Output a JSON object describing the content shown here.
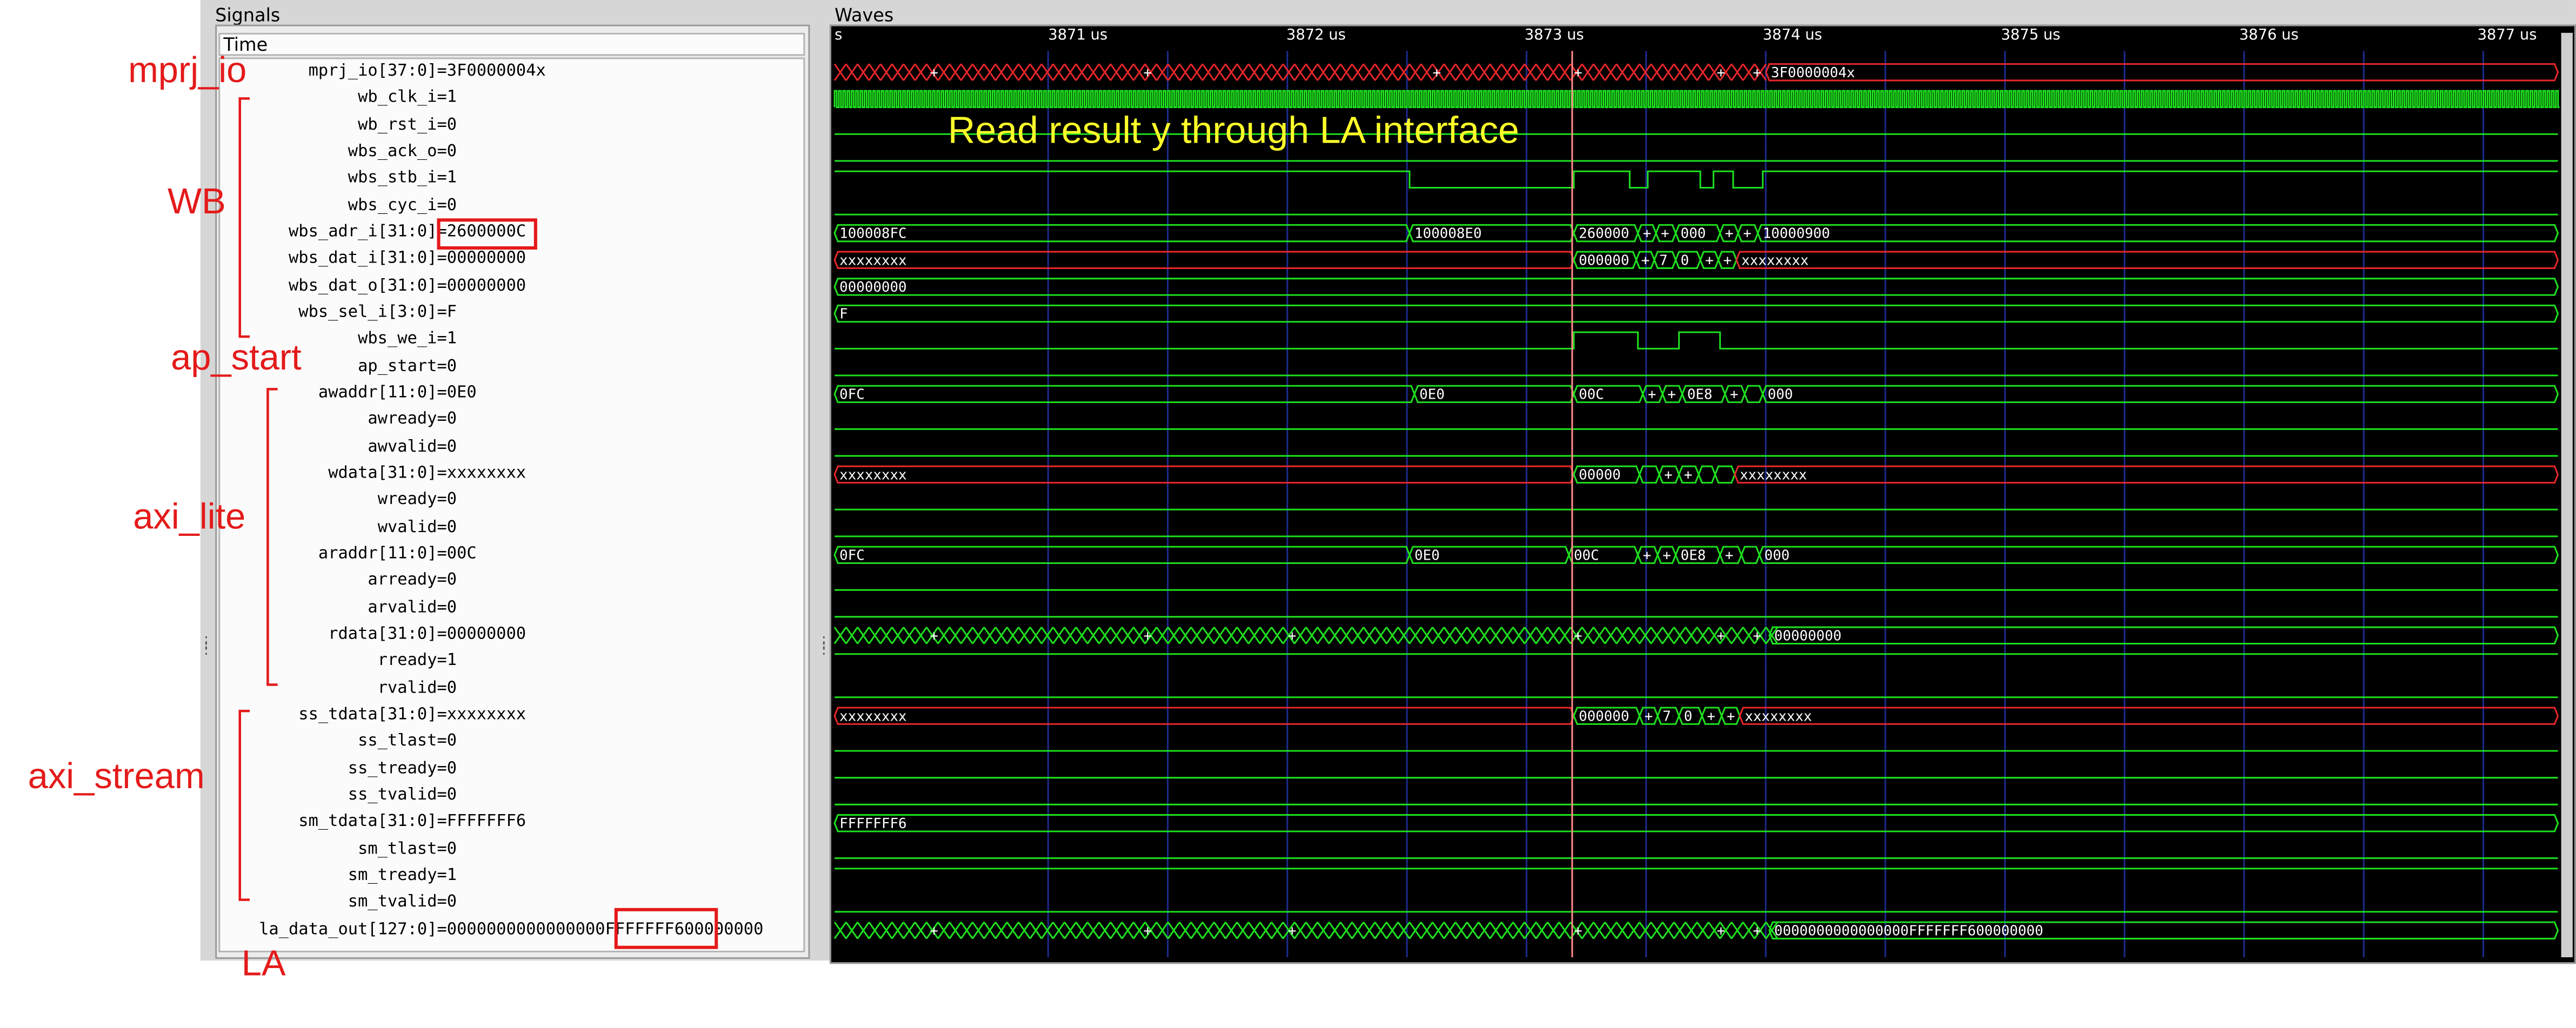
{
  "panes": {
    "signals_title": "Signals",
    "waves_title": "Waves",
    "time_header": "Time"
  },
  "time_ticks": [
    {
      "label": "s",
      "us": 3870.0
    },
    {
      "label": "3871 us",
      "us": 3871
    },
    {
      "label": "3872 us",
      "us": 3872
    },
    {
      "label": "3873 us",
      "us": 3873
    },
    {
      "label": "3874 us",
      "us": 3874
    },
    {
      "label": "3875 us",
      "us": 3875
    },
    {
      "label": "3876 us",
      "us": 3876
    },
    {
      "label": "3877 us",
      "us": 3877
    }
  ],
  "signals": [
    {
      "name": "mprj_io[37:0]",
      "value": "=3F0000004x"
    },
    {
      "name": "wb_clk_i",
      "value": "=1"
    },
    {
      "name": "wb_rst_i",
      "value": "=0"
    },
    {
      "name": "wbs_ack_o",
      "value": "=0"
    },
    {
      "name": "wbs_stb_i",
      "value": "=1"
    },
    {
      "name": "wbs_cyc_i",
      "value": "=0"
    },
    {
      "name": "wbs_adr_i[31:0]",
      "value": "=2600000C"
    },
    {
      "name": "wbs_dat_i[31:0]",
      "value": "=00000000"
    },
    {
      "name": "wbs_dat_o[31:0]",
      "value": "=00000000"
    },
    {
      "name": "wbs_sel_i[3:0]",
      "value": "=F"
    },
    {
      "name": "wbs_we_i",
      "value": "=1"
    },
    {
      "name": "ap_start",
      "value": "=0"
    },
    {
      "name": "awaddr[11:0]",
      "value": "=0E0"
    },
    {
      "name": "awready",
      "value": "=0"
    },
    {
      "name": "awvalid",
      "value": "=0"
    },
    {
      "name": "wdata[31:0]",
      "value": "=xxxxxxxx"
    },
    {
      "name": "wready",
      "value": "=0"
    },
    {
      "name": "wvalid",
      "value": "=0"
    },
    {
      "name": "araddr[11:0]",
      "value": "=00C"
    },
    {
      "name": "arready",
      "value": "=0"
    },
    {
      "name": "arvalid",
      "value": "=0"
    },
    {
      "name": "rdata[31:0]",
      "value": "=00000000"
    },
    {
      "name": "rready",
      "value": "=1"
    },
    {
      "name": "rvalid",
      "value": "=0"
    },
    {
      "name": "ss_tdata[31:0]",
      "value": "=xxxxxxxx"
    },
    {
      "name": "ss_tlast",
      "value": "=0"
    },
    {
      "name": "ss_tready",
      "value": "=0"
    },
    {
      "name": "ss_tvalid",
      "value": "=0"
    },
    {
      "name": "sm_tdata[31:0]",
      "value": "=FFFFFFF6"
    },
    {
      "name": "sm_tlast",
      "value": "=0"
    },
    {
      "name": "sm_tready",
      "value": "=1"
    },
    {
      "name": "sm_tvalid",
      "value": "=0"
    },
    {
      "name": "la_data_out[127:0]",
      "value": "=0000000000000000FFFFFFF600000000"
    }
  ],
  "annotations": {
    "mprj_io": "mprj_io",
    "wb": "WB",
    "ap_start": "ap_start",
    "axi_lite": "axi_lite",
    "axi_stream": "axi_stream",
    "la": "LA",
    "overlay": "Read result y through LA interface"
  },
  "wave_labels": {
    "mprj_final": "3F0000004x",
    "adr_a": "100008FC",
    "adr_b": "100008E0",
    "adr_c": "260000",
    "adr_d": "000",
    "adr_e": "10000900",
    "dati_a": "xxxxxxxx",
    "dati_b": "000000",
    "dati_c": "7",
    "dati_d": "0",
    "dati_e": "xxxxxxxx",
    "dato": "00000000",
    "sel": "F",
    "aw_a": "0FC",
    "aw_b": "0E0",
    "aw_c": "00C",
    "aw_d": "0E8",
    "aw_e": "000",
    "wd_a": "xxxxxxxx",
    "wd_b": "00000",
    "wd_c": "xxxxxxxx",
    "ar_a": "0FC",
    "ar_b": "0E0",
    "ar_c": "00C",
    "ar_d": "0E8",
    "ar_e": "000",
    "rdata_final": "00000000",
    "ss_a": "xxxxxxxx",
    "ss_b": "000000",
    "ss_c": "7",
    "ss_d": "0",
    "ss_e": "xxxxxxxx",
    "sm": "FFFFFFF6",
    "la_final": "0000000000000000FFFFFFF600000000",
    "plus": "+"
  },
  "colors": {
    "wave_green": "#1ee01e",
    "wave_red": "#e8262b",
    "cursor": "#ff8c8c",
    "grid": "#1c2a8c",
    "annotation": "#e41a1a",
    "overlay": "#ffff2a"
  }
}
